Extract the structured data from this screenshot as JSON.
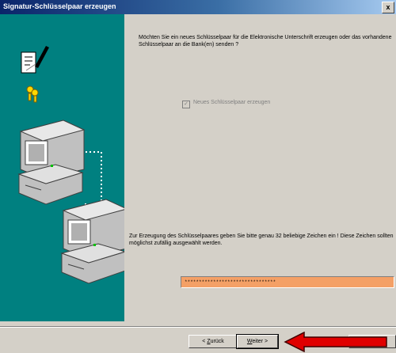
{
  "window": {
    "title": "Signatur-Schlüsselpaar erzeugen",
    "close_glyph": "x"
  },
  "content": {
    "intro": "Möchten Sie ein neues Schlüsselpaar für die Elektronische Unterschrift erzeugen oder das vorhandene Schlüsselpaar an die Bank(en) senden ?",
    "checkbox_label": "Neues Schlüsselpaar erzeugen",
    "checkbox_checked": true,
    "hint": "Zur Erzeugung des Schlüsselpaares geben Sie bitte genau 32 beliebige Zeichen ein ! Diese Zeichen sollten möglichst zufällig ausgewählt werden.",
    "input_value": "********************************"
  },
  "buttons": {
    "back_prefix": "< ",
    "back_hotkey": "Z",
    "back_rest": "urück",
    "next_hotkey": "W",
    "next_rest": "eiter >"
  },
  "colors": {
    "sidebar": "#008080",
    "input_background": "#f4a066",
    "arrow": "#e00000"
  },
  "icons": [
    "document-signature-icon",
    "keys-icon",
    "computer-icon",
    "computer-icon"
  ]
}
